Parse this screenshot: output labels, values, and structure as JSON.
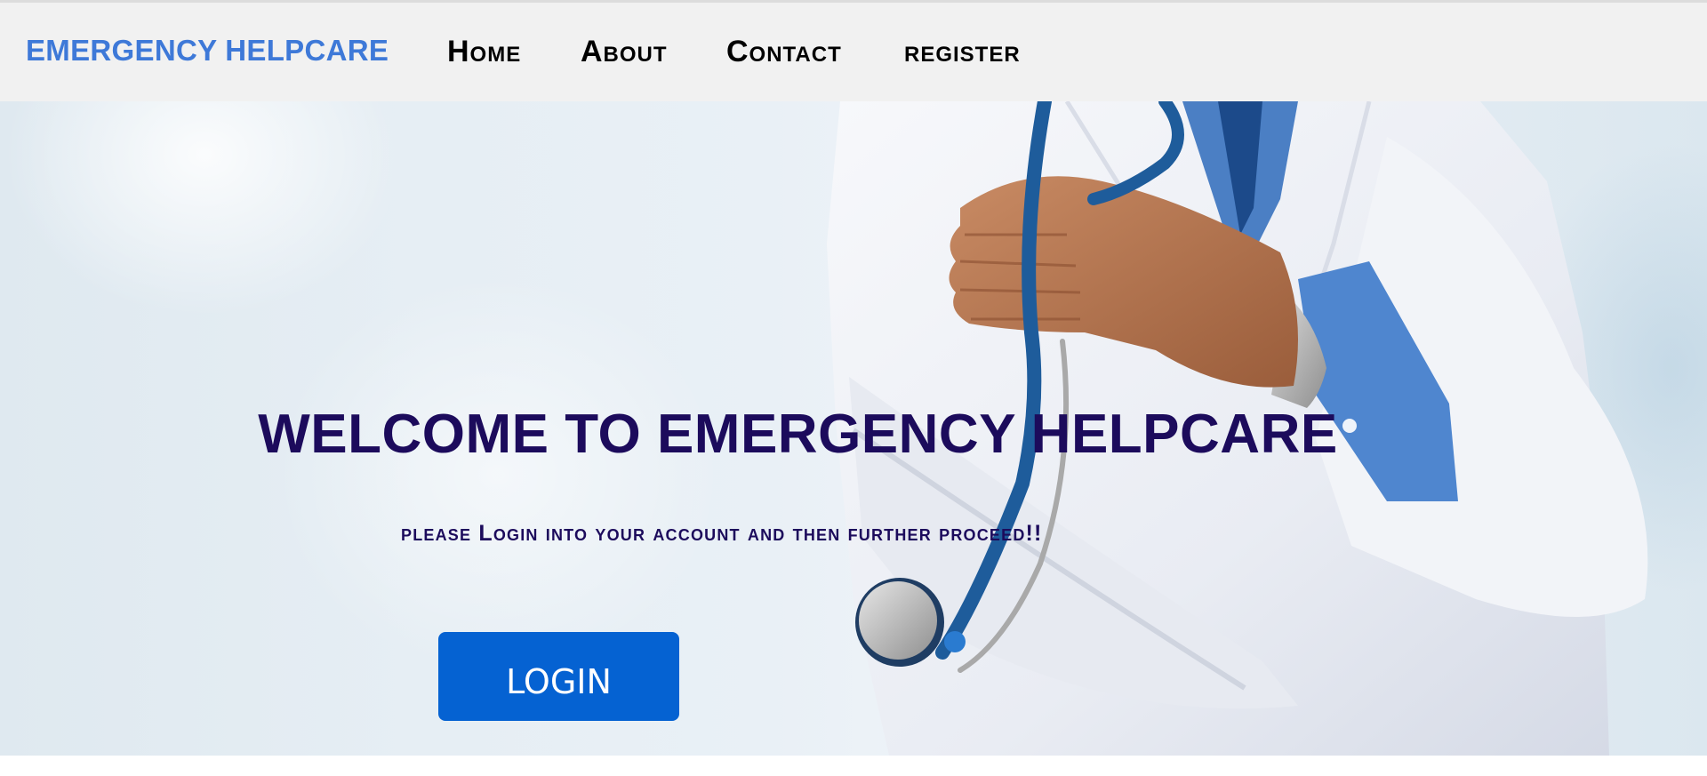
{
  "navbar": {
    "brand": "EMERGENCY HELPCARE",
    "links": {
      "home": "Home",
      "about": "About",
      "contact": "Contact",
      "register": "register"
    }
  },
  "hero": {
    "title": "WELCOME TO EMERGENCY HELPCARE",
    "subtitle": "please Login into your account and then further proceed!!",
    "login_label": "LOGIN",
    "image_description": "doctor-in-white-coat-holding-stethoscope"
  },
  "colors": {
    "brand": "#3e79d8",
    "navbar_bg": "#f1f1f1",
    "heading": "#1c0b5c",
    "button": "#0562d2"
  }
}
